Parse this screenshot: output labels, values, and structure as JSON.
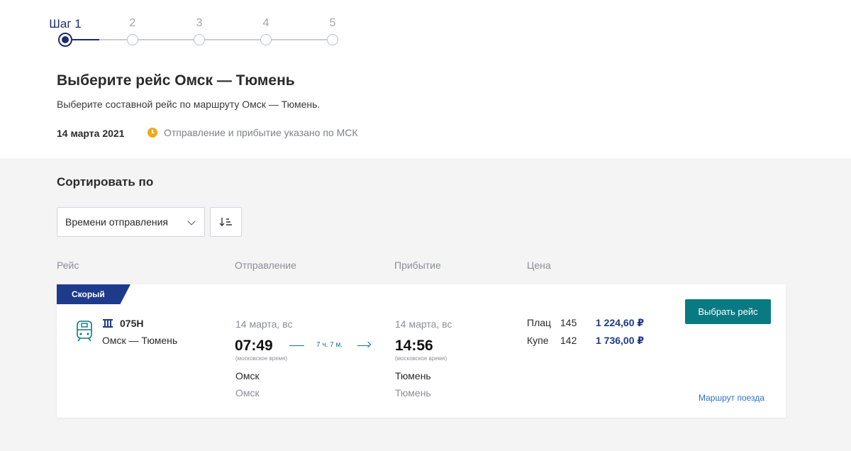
{
  "stepper": {
    "steps": [
      {
        "label": "Шаг 1",
        "current": true
      },
      {
        "label": "2"
      },
      {
        "label": "3"
      },
      {
        "label": "4"
      },
      {
        "label": "5"
      }
    ]
  },
  "header": {
    "title": "Выберите рейс Омск — Тюмень",
    "subtitle": "Выберите составной рейс по маршруту Омск — Тюмень.",
    "date": "14 марта 2021",
    "tz_note": "Отправление и прибытие указано по МСК"
  },
  "sort": {
    "title": "Сортировать по",
    "selected": "Времени отправления"
  },
  "columns": {
    "trip": "Рейс",
    "departure": "Отправление",
    "arrival": "Прибытие",
    "price": "Цена"
  },
  "trip": {
    "badge": "Скорый",
    "train_number": "075Н",
    "route": "Омск — Тюмень",
    "departure": {
      "date": "14 марта, вс",
      "time": "07:49",
      "tz": "(московское время)",
      "city": "Омск",
      "station": "Омск"
    },
    "duration": "7 ч. 7 м.",
    "arrival": {
      "date": "14 марта, вс",
      "time": "14:56",
      "tz": "(московское время)",
      "city": "Тюмень",
      "station": "Тюмень"
    },
    "fares": [
      {
        "class": "Плац",
        "seats": "145",
        "price": "1 224,60 ₽"
      },
      {
        "class": "Купе",
        "seats": "142",
        "price": "1 736,00 ₽"
      }
    ],
    "select_label": "Выбрать рейс",
    "route_link": "Маршрут поезда"
  },
  "colors": {
    "primary_navy": "#1e2c6c",
    "accent_teal": "#0a7a82",
    "badge_blue": "#1e3a8a",
    "link_blue": "#2f72c4",
    "clock_orange": "#f2a81d"
  }
}
